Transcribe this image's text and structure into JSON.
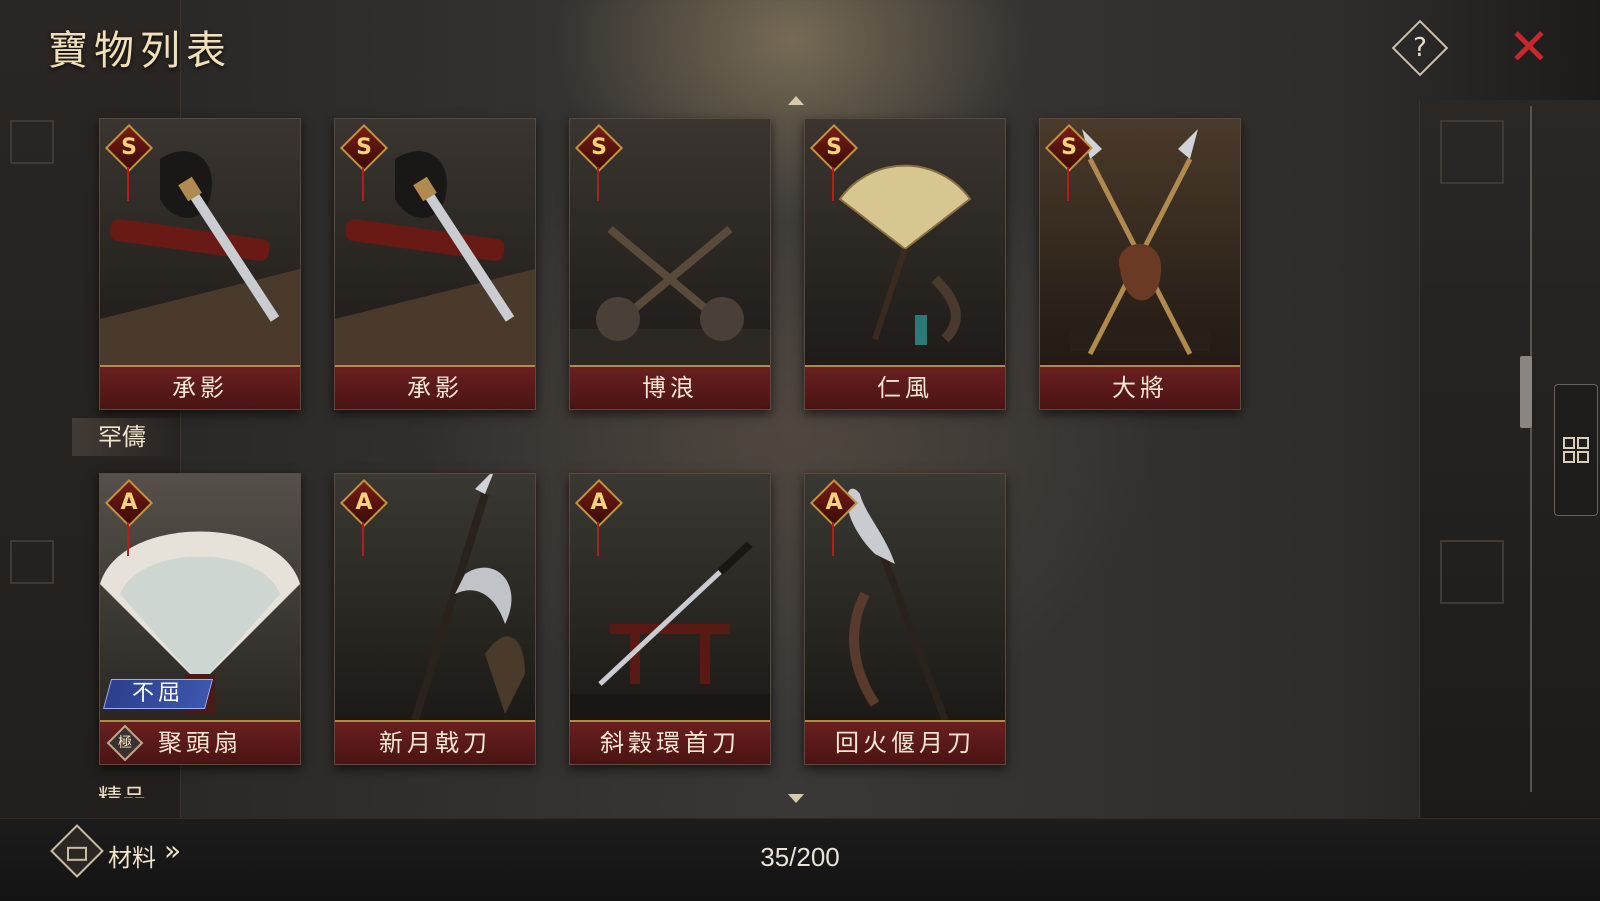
{
  "header": {
    "title": "寶物列表",
    "help_label": "?",
    "close_label": "✕"
  },
  "sections": [
    {
      "label": "",
      "items": [
        {
          "name": "承影",
          "grade": "S",
          "art": "sword"
        },
        {
          "name": "承影",
          "grade": "S",
          "art": "sword"
        },
        {
          "name": "博浪",
          "grade": "S",
          "art": "mace"
        },
        {
          "name": "仁風",
          "grade": "S",
          "art": "fan"
        },
        {
          "name": "大將",
          "grade": "S",
          "art": "spear"
        }
      ]
    },
    {
      "label": "罕儔",
      "items": [
        {
          "name": "聚頭扇",
          "grade": "A",
          "art": "feather-fan",
          "tag": "不屈",
          "ji": "極"
        },
        {
          "name": "新月戟刀",
          "grade": "A",
          "art": "halberd"
        },
        {
          "name": "斜穀環首刀",
          "grade": "A",
          "art": "katana"
        },
        {
          "name": "回火偃月刀",
          "grade": "A",
          "art": "glaive"
        }
      ]
    }
  ],
  "next_section_label": "精品",
  "footer": {
    "materials_label": "材料",
    "materials_arrow": "»",
    "count": "35/200"
  },
  "colors": {
    "close": "#c8282c",
    "name_bar": "#5a1818",
    "grade_gold": "#f6d27a"
  }
}
